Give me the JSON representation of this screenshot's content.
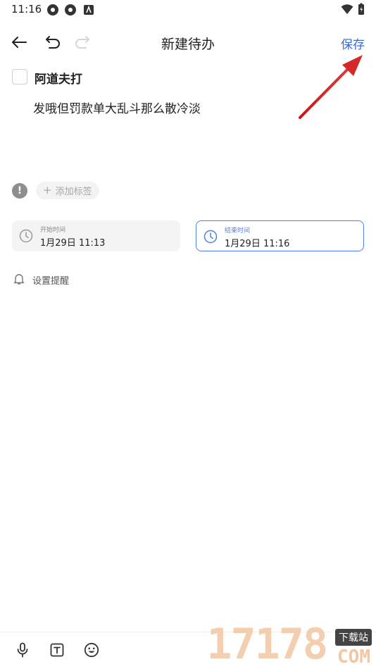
{
  "status_bar": {
    "time": "11:16"
  },
  "header": {
    "title": "新建待办",
    "save_label": "保存"
  },
  "task": {
    "title": "阿道夫打",
    "description": "发哦但罚款单大乱斗那么散冷淡"
  },
  "tags": {
    "add_label": "添加标签"
  },
  "schedule": {
    "start": {
      "label": "开始时间",
      "value": "1月29日 11:13"
    },
    "end": {
      "label": "结束时间",
      "value": "1月29日 11:16"
    }
  },
  "reminder": {
    "label": "设置提醒"
  },
  "watermark": {
    "number": "17178",
    "badge": "下载站",
    "domain": "COM"
  },
  "colors": {
    "accent": "#2f6be6",
    "annotation_arrow": "#d4282a"
  },
  "icons": [
    "back-arrow-icon",
    "undo-icon",
    "redo-icon",
    "info-icon",
    "plus-icon",
    "clock-icon",
    "bell-icon",
    "microphone-icon",
    "text-format-icon",
    "emoji-icon",
    "wifi-icon",
    "battery-icon"
  ]
}
